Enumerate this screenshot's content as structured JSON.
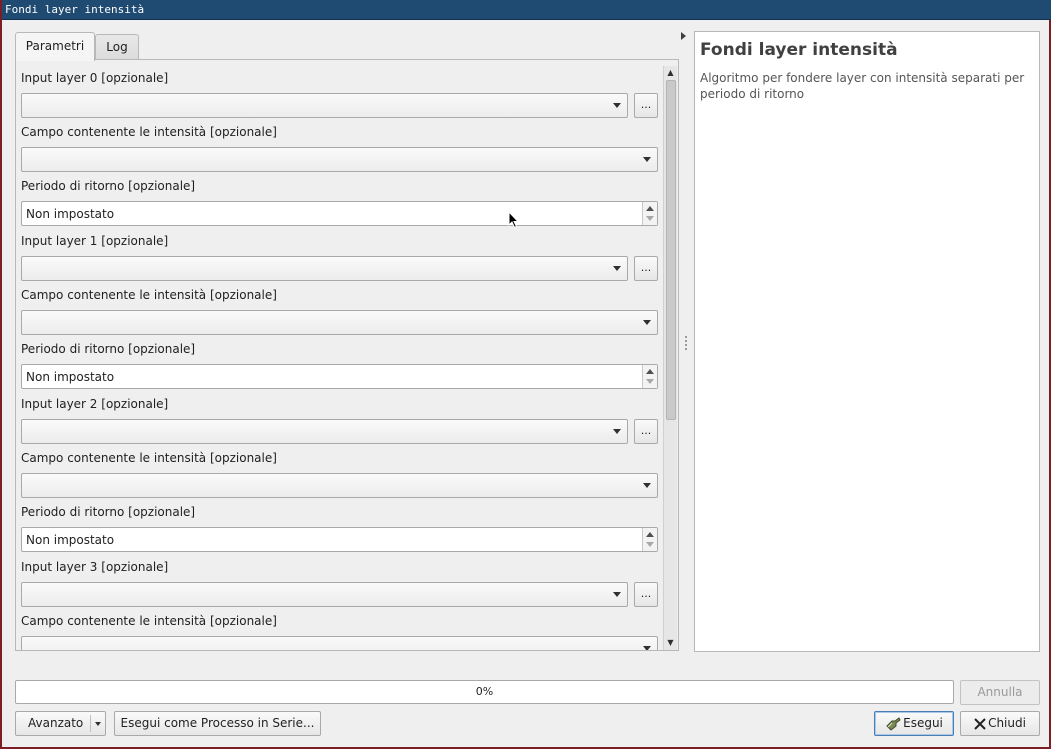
{
  "window": {
    "title": "Fondi layer intensità"
  },
  "tabs": [
    {
      "label": "Parametri",
      "active": true
    },
    {
      "label": "Log",
      "active": false
    }
  ],
  "parameters": [
    {
      "label": "Input layer 0 [opzionale]",
      "type": "layer_combo"
    },
    {
      "label": "Campo contenente le intensità [opzionale]",
      "type": "field_combo"
    },
    {
      "label": "Periodo di ritorno [opzionale]",
      "type": "spinbox",
      "value": "Non impostato"
    },
    {
      "label": "Input layer 1 [opzionale]",
      "type": "layer_combo"
    },
    {
      "label": "Campo contenente le intensità [opzionale]",
      "type": "field_combo"
    },
    {
      "label": "Periodo di ritorno [opzionale]",
      "type": "spinbox",
      "value": "Non impostato"
    },
    {
      "label": "Input layer 2 [opzionale]",
      "type": "layer_combo"
    },
    {
      "label": "Campo contenente le intensità [opzionale]",
      "type": "field_combo"
    },
    {
      "label": "Periodo di ritorno [opzionale]",
      "type": "spinbox",
      "value": "Non impostato"
    },
    {
      "label": "Input layer 3 [opzionale]",
      "type": "layer_combo"
    },
    {
      "label": "Campo contenente le intensità [opzionale]",
      "type": "field_combo"
    }
  ],
  "browse_label": "...",
  "help": {
    "title": "Fondi layer intensità",
    "description": "Algoritmo per fondere layer con intensità separati per periodo di ritorno"
  },
  "progress": {
    "value": 0,
    "text": "0%"
  },
  "buttons": {
    "annulla": "Annulla",
    "avanzato": "Avanzato",
    "esegui_serie": "Esegui come Processo in Serie...",
    "esegui": "Esegui",
    "chiudi": "Chiudi"
  }
}
